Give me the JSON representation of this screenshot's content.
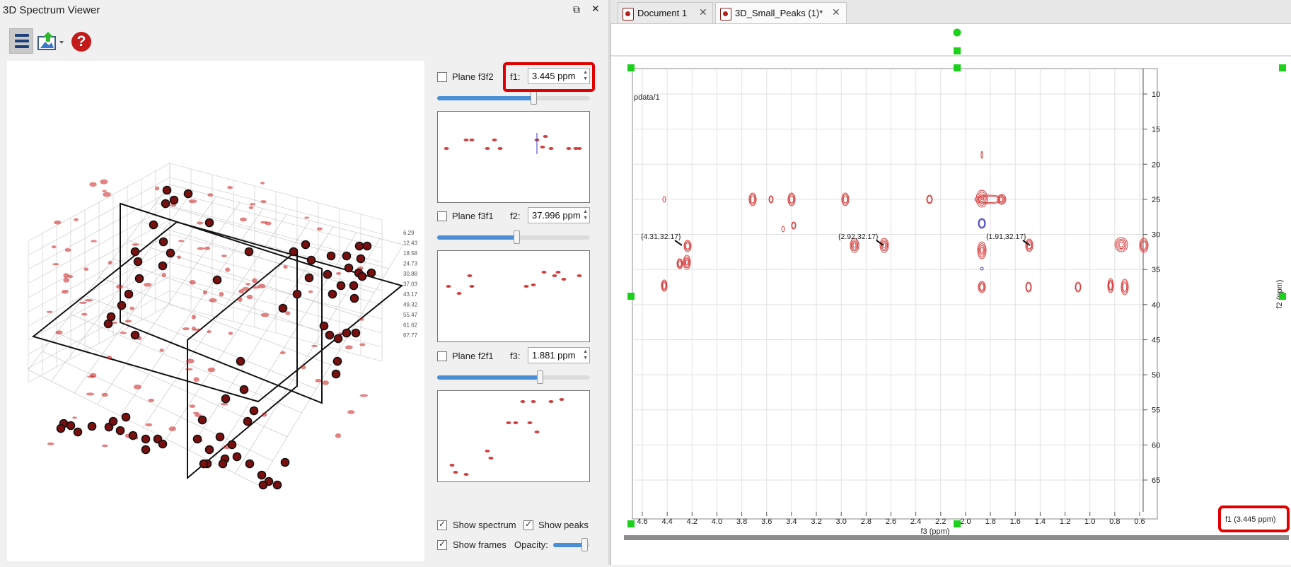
{
  "dock": {
    "title": "3D Spectrum Viewer",
    "buttons": {
      "float": "⧉",
      "close": "✕"
    },
    "toolbar": [
      "menu-icon",
      "export-icon",
      "help-icon"
    ]
  },
  "planes": [
    {
      "label": "Plane f3f2",
      "checked": false,
      "dim": "f1:",
      "value": "3.445 ppm",
      "slider": 0.63
    },
    {
      "label": "Plane f3f1",
      "checked": false,
      "dim": "f2:",
      "value": "37.996 ppm",
      "slider": 0.52
    },
    {
      "label": "Plane f2f1",
      "checked": false,
      "dim": "f3:",
      "value": "1.881 ppm",
      "slider": 0.67
    }
  ],
  "options": {
    "show_spectrum": "Show spectrum",
    "show_peaks": "Show peaks",
    "show_frames": "Show frames",
    "opacity": "Opacity:",
    "opacity_value": 0.85
  },
  "plot3d": {
    "z_ticks": [
      "6.29",
      "12.43",
      "18.58",
      "24.73",
      "30.88",
      "37.03",
      "43.17",
      "49.32",
      "55.47",
      "61.62",
      "67.77"
    ]
  },
  "tabs": [
    {
      "label": "Document 1",
      "active": false
    },
    {
      "label": "3D_Small_Peaks (1)*",
      "active": true
    }
  ],
  "colors": {
    "peak": "#c81e1e",
    "positive": "#d24040",
    "negative": "#3a3ab8",
    "highlight": "#e00000",
    "handle": "#1bd11b"
  },
  "spectrum": {
    "dataset_label": "pdata/1",
    "x_axis": {
      "label": "f3 (ppm)",
      "ticks": [
        "4.6",
        "4.4",
        "4.2",
        "4.0",
        "3.8",
        "3.6",
        "3.4",
        "3.2",
        "3.0",
        "2.8",
        "2.6",
        "2.4",
        "2.2",
        "2.0",
        "1.8",
        "1.6",
        "1.4",
        "1.2",
        "1.0",
        "0.8",
        "0.6"
      ]
    },
    "y_axis": {
      "label": "f2 (ppm)",
      "ticks": [
        "10",
        "15",
        "20",
        "25",
        "30",
        "35",
        "40",
        "45",
        "50",
        "55",
        "60",
        "65"
      ]
    },
    "annotations": [
      "{4.31,32.17}",
      "{2.92,32.17}",
      "{1.91,32.17}"
    ],
    "plane_label": "f1 (3.445 ppm)"
  }
}
